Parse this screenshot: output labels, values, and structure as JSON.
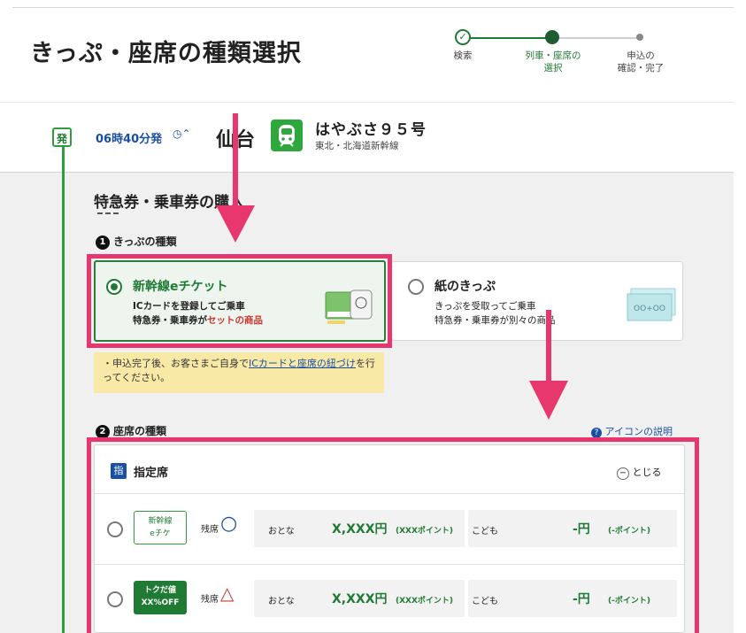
{
  "page": {
    "title": "きっぷ・座席の種類選択"
  },
  "steps": [
    {
      "label": "検索"
    },
    {
      "label": "列車・座席の",
      "label2": "選択"
    },
    {
      "label": "申込の",
      "label2": "確認・完了"
    }
  ],
  "train": {
    "dep_badge": "発",
    "dep_time": "06時40分発",
    "dep_time_toggle": "◷⌃",
    "station": "仙台",
    "name": "はやぶさ９５号",
    "line": "東北・北海道新幹線"
  },
  "section": {
    "title": "特急券・乗車券の購入",
    "ticket_type_num": "1",
    "ticket_type_label": "きっぷの種類",
    "seat_type_num": "2",
    "seat_type_label": "座席の種類",
    "icon_help": "アイコンの説明",
    "icon_help_mark": "?"
  },
  "ticket_options": [
    {
      "title": "新幹線eチケット",
      "desc1": "ICカードを登録してご乗車",
      "desc2a": "特急券・乗車券が",
      "desc2b": "セットの商品",
      "selected": true
    },
    {
      "title": "紙のきっぷ",
      "desc1": "きっぷを受取ってご乗車",
      "desc2": "特急券・乗車券が別々の商品",
      "ticket_graphic": "OO+OO",
      "selected": false
    }
  ],
  "note": {
    "prefix": "・申込完了後、お客さまご自身で",
    "link": "ICカードと座席の紐づけ",
    "suffix": "を行ってください。"
  },
  "seat_panel": {
    "icon": "指",
    "title": "指定席",
    "collapse_label": "とじる",
    "collapse_mark": "−"
  },
  "seat_rows": [
    {
      "badge_l1": "新幹線",
      "badge_l2": "eチケ",
      "availability": "残席",
      "status_symbol": "○",
      "adult_label": "おとな",
      "adult_price": "X,XXX円",
      "adult_points": "(XXXポイント)",
      "child_label": "こども",
      "child_price": "-円",
      "child_points": "(-ポイント)"
    },
    {
      "badge_l1": "トクだ値",
      "badge_l2": "XX%OFF",
      "availability": "残席",
      "status_symbol": "△",
      "adult_label": "おとな",
      "adult_price": "X,XXX円",
      "adult_points": "(XXXポイント)",
      "child_label": "こども",
      "child_price": "-円",
      "child_points": "(-ポイント)"
    }
  ],
  "colors": {
    "accent_green": "#1f7a33",
    "highlight_pink": "#e8366f",
    "note_yellow": "#f9e9a7",
    "link_blue": "#1a4fa3"
  }
}
